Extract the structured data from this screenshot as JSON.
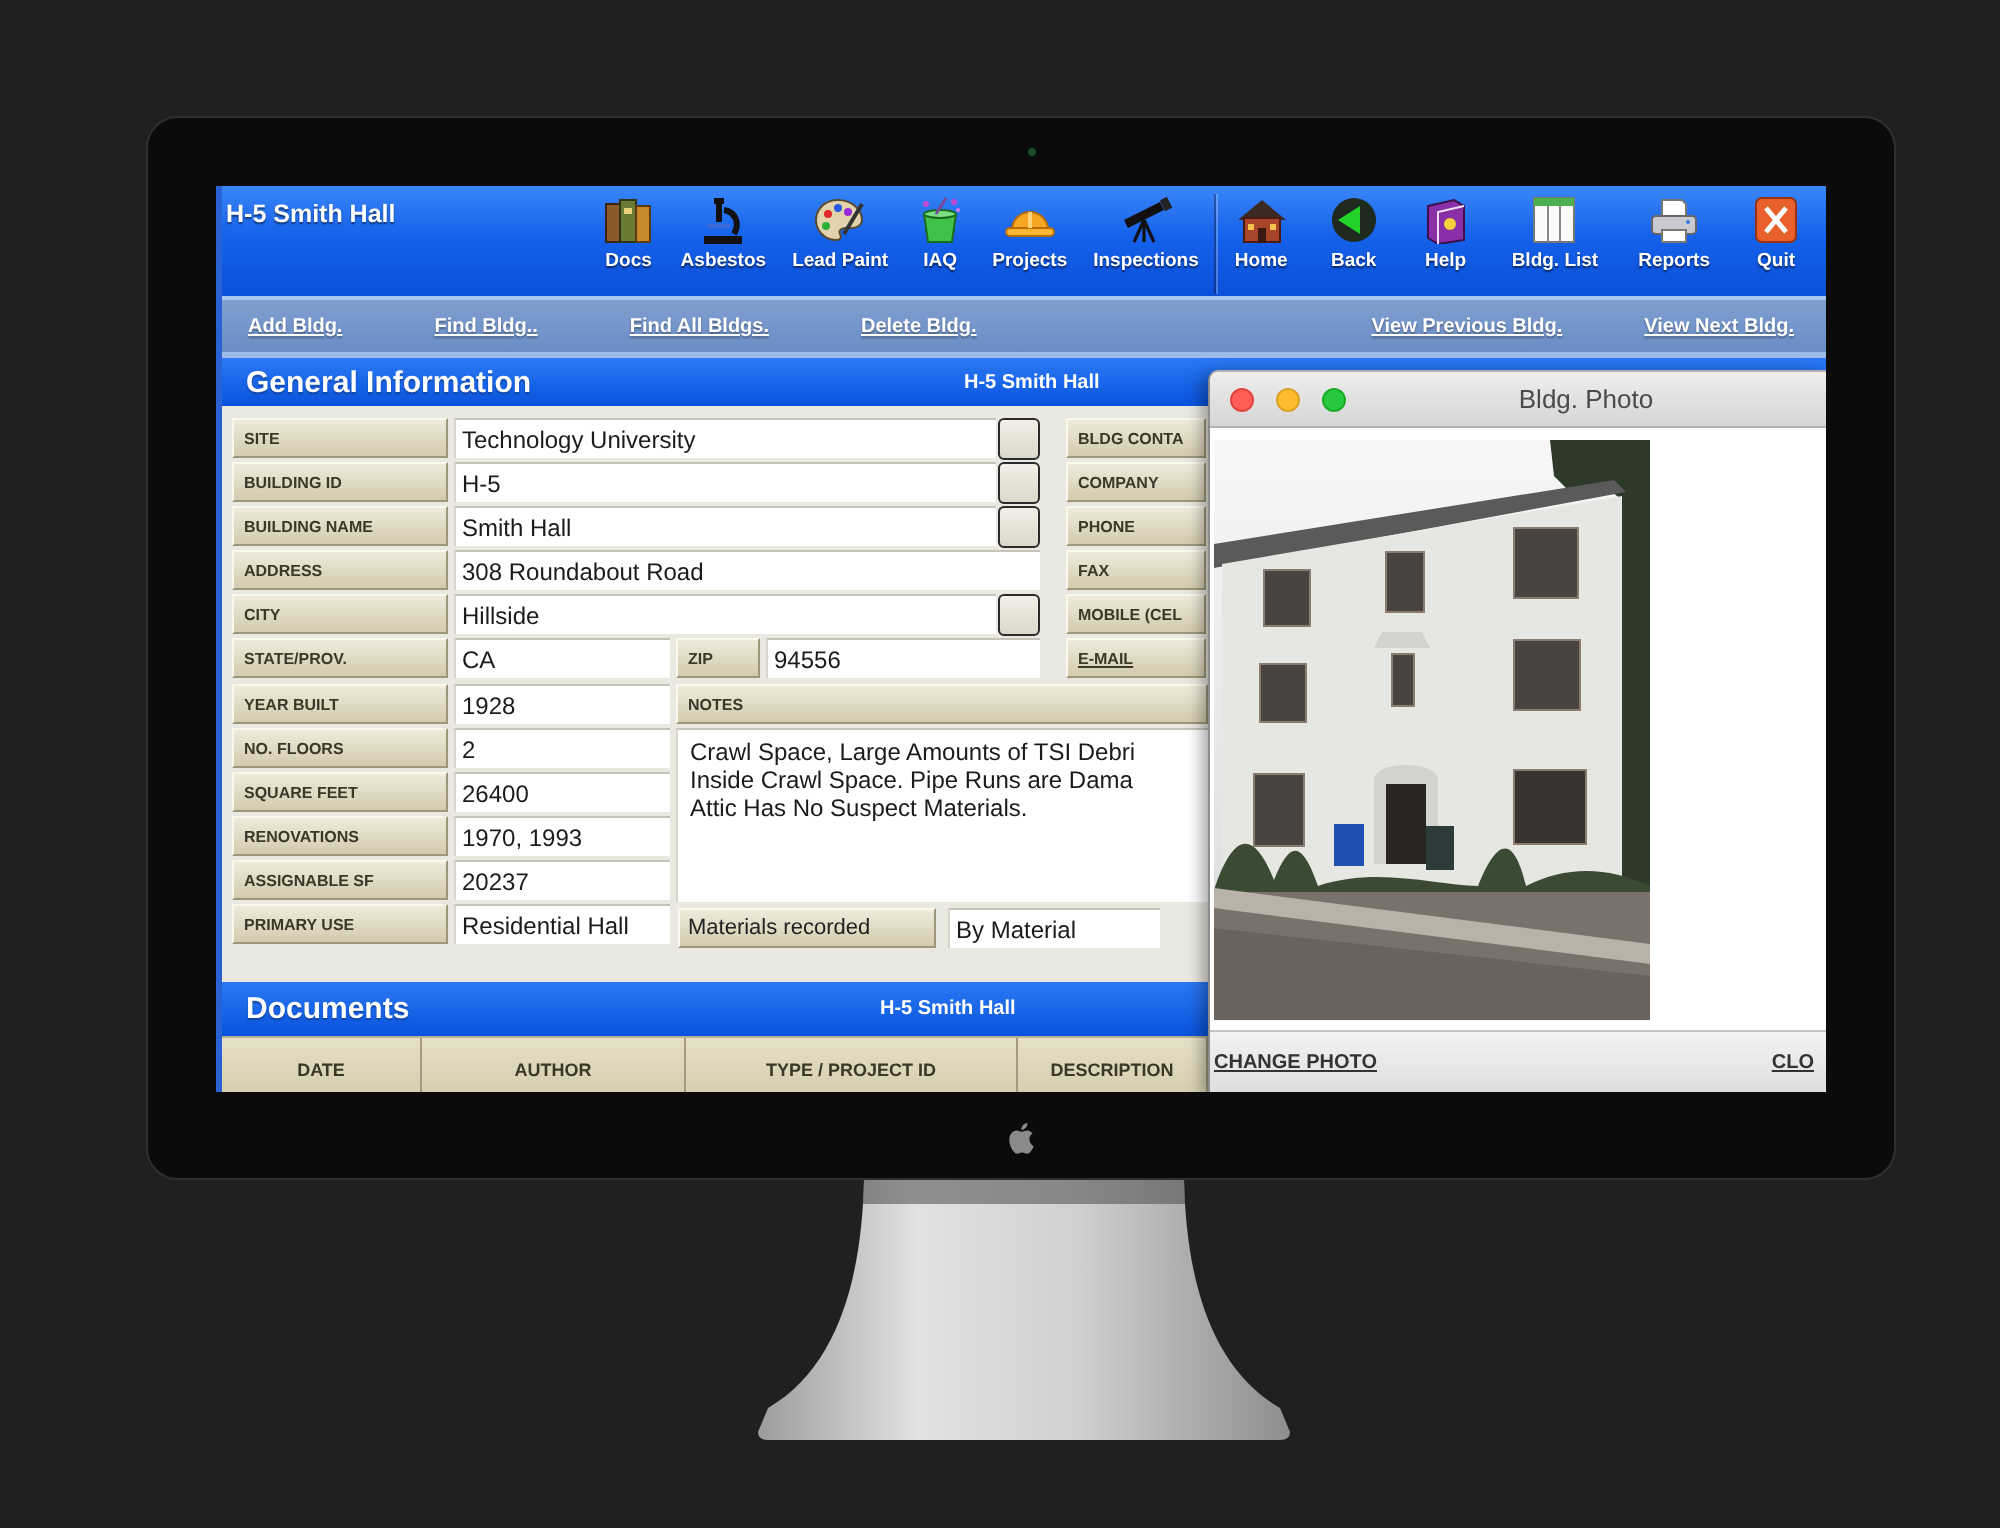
{
  "window": {
    "title": "H-5 Smith Hall"
  },
  "toolbar": {
    "modules": [
      {
        "label": "Docs",
        "kind": "docs"
      },
      {
        "label": "Asbestos",
        "kind": "microscope"
      },
      {
        "label": "Lead Paint",
        "kind": "palette"
      },
      {
        "label": "IAQ",
        "kind": "bucket"
      },
      {
        "label": "Projects",
        "kind": "hardhat"
      },
      {
        "label": "Inspections",
        "kind": "telescope"
      }
    ],
    "navigation": [
      {
        "label": "Home",
        "kind": "house"
      },
      {
        "label": "Back",
        "kind": "back"
      },
      {
        "label": "Help",
        "kind": "book"
      },
      {
        "label": "Bldg. List",
        "kind": "list"
      },
      {
        "label": "Reports",
        "kind": "printer"
      },
      {
        "label": "Quit",
        "kind": "quit"
      }
    ]
  },
  "record_links": [
    "Add Bldg.",
    "Find Bldg..",
    "Find All Bldgs.",
    "Delete Bldg."
  ],
  "browse_links": [
    "View Previous Bldg.",
    "View Next Bldg."
  ],
  "general_information": {
    "title": "General Information",
    "subtitle": "H-5 Smith Hall",
    "fields": [
      {
        "label": "SITE",
        "value": "Technology University",
        "picker": true
      },
      {
        "label": "BUILDING ID",
        "value": "H-5",
        "picker": true
      },
      {
        "label": "BUILDING NAME",
        "value": "Smith Hall",
        "picker": true
      },
      {
        "label": "ADDRESS",
        "value": "308 Roundabout Road",
        "picker": false
      },
      {
        "label": "CITY",
        "value": "Hillside",
        "picker": true
      }
    ],
    "state": {
      "label": "STATE/PROV.",
      "value": "CA"
    },
    "zip": {
      "label": "ZIP",
      "value": "94556"
    },
    "details": [
      {
        "label": "YEAR BUILT",
        "value": "1928"
      },
      {
        "label": "NO. FLOORS",
        "value": "2"
      },
      {
        "label": "SQUARE FEET",
        "value": "26400"
      },
      {
        "label": "RENOVATIONS",
        "value": "1970, 1993"
      },
      {
        "label": "ASSIGNABLE SF",
        "value": "20237"
      },
      {
        "label": "PRIMARY USE",
        "value": "Residential Hall"
      }
    ],
    "notes": {
      "label": "NOTES",
      "lines": [
        "Crawl Space, Large Amounts of TSI Debri",
        "Inside Crawl Space. Pipe Runs are Dama",
        "Attic Has No Suspect Materials."
      ]
    },
    "materials": {
      "button": "Materials recorded",
      "value": "By Material"
    },
    "contact_labels": [
      {
        "label": "BLDG CONTA",
        "kind": "text"
      },
      {
        "label": "COMPANY",
        "kind": "text"
      },
      {
        "label": "PHONE",
        "kind": "text"
      },
      {
        "label": "FAX",
        "kind": "text"
      },
      {
        "label": "MOBILE (CEL",
        "kind": "text"
      },
      {
        "label": "E-MAIL",
        "kind": "link"
      }
    ]
  },
  "documents": {
    "title": "Documents",
    "subtitle": "H-5 Smith Hall",
    "columns": [
      "DATE",
      "AUTHOR",
      "TYPE / PROJECT ID",
      "DESCRIPTION"
    ]
  },
  "photo_window": {
    "title": "Bldg. Photo",
    "links": [
      "CHANGE PHOTO",
      "CLO"
    ]
  }
}
